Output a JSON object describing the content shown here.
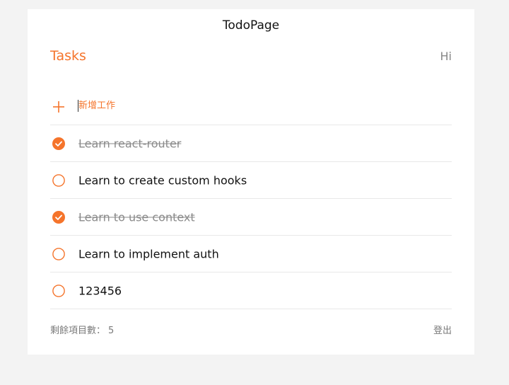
{
  "app": {
    "title": "TodoPage"
  },
  "header": {
    "tasks_title": "Tasks",
    "greeting": "Hi"
  },
  "add": {
    "placeholder": "新增工作",
    "icon": "plus-icon"
  },
  "todos": [
    {
      "text": "Learn react-router",
      "done": true
    },
    {
      "text": "Learn to create custom hooks",
      "done": false
    },
    {
      "text": "Learn to use context",
      "done": true
    },
    {
      "text": "Learn to implement auth",
      "done": false
    },
    {
      "text": "123456",
      "done": false
    }
  ],
  "footer": {
    "remaining_label": "剩餘項目數：",
    "remaining_count": "5",
    "logout_label": "登出"
  },
  "colors": {
    "accent": "#f5742b",
    "background": "#f3f3f3",
    "card": "#ffffff",
    "done_text": "#8a8a8a"
  }
}
